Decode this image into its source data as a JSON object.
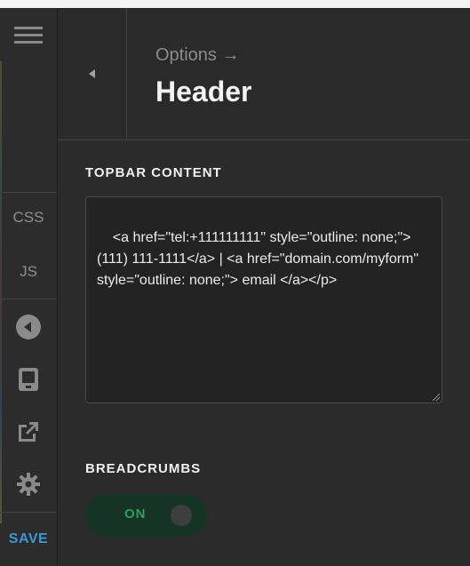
{
  "rail": {
    "css_label": "CSS",
    "js_label": "JS",
    "save_label": "SAVE",
    "icons": [
      "menu-icon",
      "back-circle-icon",
      "device-icon",
      "external-link-icon",
      "gear-icon"
    ]
  },
  "header": {
    "breadcrumb": "Options →",
    "title": "Header"
  },
  "topbar": {
    "label": "TOPBAR CONTENT",
    "value": "<a href=\"tel:+111111111\" style=\"outline: none;\"> (111) 111-1111</a> | <a href=\"domain.com/myform\" style=\"outline: none;\"> email </a></p>"
  },
  "breadcrumbs": {
    "label": "BREADCRUMBS",
    "toggle_label": "ON",
    "enabled": true
  },
  "colors": {
    "accent_save": "#3d97d6",
    "toggle_on_text": "#2f9e5f",
    "toggle_on_bg": "#163426"
  }
}
